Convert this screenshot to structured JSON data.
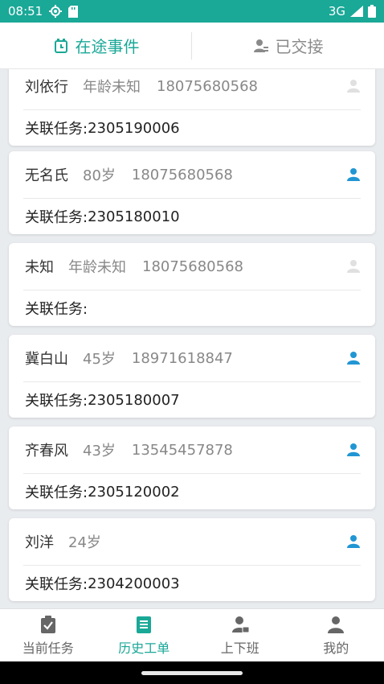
{
  "status_bar": {
    "time": "08:51",
    "network": "3G"
  },
  "tabs": [
    {
      "label": "在途事件",
      "icon": "alarm-clock-icon",
      "active": true
    },
    {
      "label": "已交接",
      "icon": "user-handover-icon",
      "active": false
    }
  ],
  "records": [
    {
      "name": "刘依行",
      "age": "年龄未知",
      "phone": "18075680568",
      "task_label": "关联任务:",
      "task_id": "2305190006",
      "person_active": false
    },
    {
      "name": "无名氏",
      "age": "80岁",
      "phone": "18075680568",
      "task_label": "关联任务:",
      "task_id": "2305180010",
      "person_active": true
    },
    {
      "name": "未知",
      "age": "年龄未知",
      "phone": "18075680568",
      "task_label": "关联任务:",
      "task_id": "",
      "person_active": false
    },
    {
      "name": "冀白山",
      "age": "45岁",
      "phone": "18971618847",
      "task_label": "关联任务:",
      "task_id": "2305180007",
      "person_active": true
    },
    {
      "name": "齐春风",
      "age": "43岁",
      "phone": "13545457878",
      "task_label": "关联任务:",
      "task_id": "2305120002",
      "person_active": true
    },
    {
      "name": "刘洋",
      "age": "24岁",
      "phone": "",
      "task_label": "关联任务:",
      "task_id": "2304200003",
      "person_active": true
    }
  ],
  "bottom_nav": [
    {
      "label": "当前任务",
      "icon": "clipboard-check-icon",
      "active": false
    },
    {
      "label": "历史工单",
      "icon": "document-list-icon",
      "active": true
    },
    {
      "label": "上下班",
      "icon": "user-card-icon",
      "active": false
    },
    {
      "label": "我的",
      "icon": "user-icon",
      "active": false
    }
  ],
  "colors": {
    "accent": "#1aa897",
    "person_active": "#2196d3",
    "person_inactive": "#e0e0e0",
    "background": "#e9ecef"
  }
}
